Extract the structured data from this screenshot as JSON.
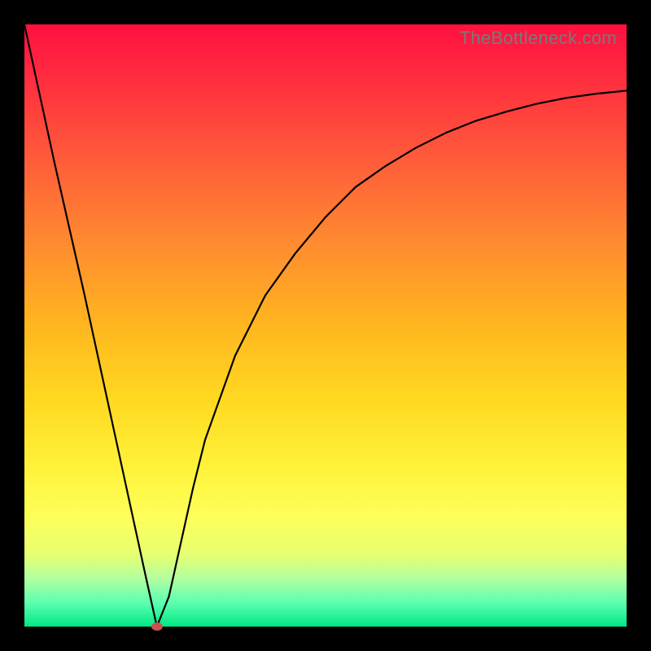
{
  "watermark": "TheBottleneck.com",
  "colors": {
    "frame": "#000000",
    "curve": "#000000",
    "marker": "#c9534c"
  },
  "chart_data": {
    "type": "line",
    "title": "",
    "xlabel": "",
    "ylabel": "",
    "xlim": [
      0,
      100
    ],
    "ylim": [
      0,
      100
    ],
    "grid": false,
    "series": [
      {
        "name": "curve",
        "x": [
          0,
          5,
          10,
          15,
          20,
          22,
          24,
          26,
          28,
          30,
          35,
          40,
          45,
          50,
          55,
          60,
          65,
          70,
          75,
          80,
          85,
          90,
          95,
          100
        ],
        "y": [
          100,
          77,
          55,
          32,
          9,
          0,
          5,
          14,
          23,
          31,
          45,
          55,
          62,
          68,
          73,
          76.5,
          79.5,
          82,
          84,
          85.5,
          86.8,
          87.8,
          88.5,
          89
        ]
      }
    ],
    "marker": {
      "x": 22,
      "y": 0
    },
    "background": "red-yellow-green-vertical-gradient"
  }
}
